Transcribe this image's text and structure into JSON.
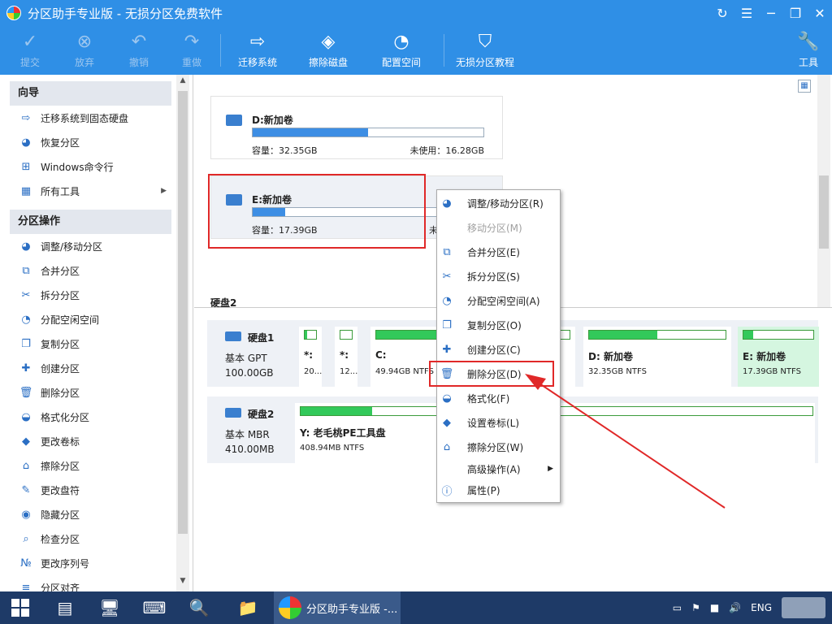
{
  "window": {
    "title": "分区助手专业版 - 无损分区免费软件",
    "controls": [
      "↻",
      "☰",
      "─",
      "❐",
      "✕"
    ]
  },
  "toolbar": {
    "commit": "提交",
    "discard": "放弃",
    "undo": "撤销",
    "redo": "重做",
    "migrate_os": "迁移系统",
    "wipe_disk": "擦除磁盘",
    "allocate_space": "配置空间",
    "tutorial": "无损分区教程",
    "tools": "工具"
  },
  "sidebar": {
    "wizard_title": "向导",
    "wizard_items": [
      {
        "label": "迁移系统到固态硬盘",
        "icon": "migrate-icon"
      },
      {
        "label": "恢复分区",
        "icon": "recover-icon"
      },
      {
        "label": "Windows命令行",
        "icon": "windows-icon"
      },
      {
        "label": "所有工具",
        "icon": "grid-icon"
      }
    ],
    "ops_title": "分区操作",
    "ops_items": [
      {
        "label": "调整/移动分区",
        "icon": "resize-icon"
      },
      {
        "label": "合并分区",
        "icon": "merge-icon"
      },
      {
        "label": "拆分分区",
        "icon": "split-icon"
      },
      {
        "label": "分配空闲空间",
        "icon": "pie-icon"
      },
      {
        "label": "复制分区",
        "icon": "copy-icon"
      },
      {
        "label": "创建分区",
        "icon": "create-icon"
      },
      {
        "label": "删除分区",
        "icon": "trash-icon"
      },
      {
        "label": "格式化分区",
        "icon": "format-icon"
      },
      {
        "label": "更改卷标",
        "icon": "tag-icon"
      },
      {
        "label": "擦除分区",
        "icon": "wipe-icon"
      },
      {
        "label": "更改盘符",
        "icon": "pencil-icon"
      },
      {
        "label": "隐藏分区",
        "icon": "eye-icon"
      },
      {
        "label": "检查分区",
        "icon": "search-icon"
      },
      {
        "label": "更改序列号",
        "icon": "serial-icon"
      },
      {
        "label": "分区对齐",
        "icon": "align-icon"
      }
    ]
  },
  "volumes": [
    {
      "name": "D:新加卷",
      "capacity": "容量：32.35GB",
      "free": "未使用：16.28GB",
      "used_fraction": 0.5
    },
    {
      "name": "E:新加卷",
      "capacity": "容量：17.39GB",
      "free": "未使",
      "used_fraction": 0.14
    }
  ],
  "disk2_label": "硬盘2",
  "disks": [
    {
      "name": "硬盘1",
      "type": "基本 GPT",
      "size": "100.00GB",
      "partitions": [
        {
          "name": "*:",
          "detail": "20...",
          "used_fraction": 0.2
        },
        {
          "name": "*:",
          "detail": "12...",
          "used_fraction": 0.0
        },
        {
          "name": "C:",
          "detail": "49.94GB NTFS",
          "used_fraction": 0.55
        },
        {
          "name": "",
          "detail": "",
          "used_fraction": 0.3
        },
        {
          "name": "D: 新加卷",
          "detail": "32.35GB NTFS",
          "used_fraction": 0.5
        },
        {
          "name": "E: 新加卷",
          "detail": "17.39GB NTFS",
          "used_fraction": 0.14
        }
      ]
    },
    {
      "name": "硬盘2",
      "type": "基本 MBR",
      "size": "410.00MB",
      "partitions": [
        {
          "name": "Y: 老毛桃PE工具盘",
          "detail": "408.94MB NTFS",
          "used_fraction": 0.14
        }
      ]
    }
  ],
  "context_menu": [
    {
      "label": "调整/移动分区(R)",
      "icon": "resize-icon",
      "enabled": true
    },
    {
      "label": "移动分区(M)",
      "icon": "",
      "enabled": false
    },
    {
      "label": "合并分区(E)",
      "icon": "merge-icon",
      "enabled": true
    },
    {
      "label": "拆分分区(S)",
      "icon": "split-icon",
      "enabled": true
    },
    {
      "label": "分配空闲空间(A)",
      "icon": "pie-icon",
      "enabled": true
    },
    {
      "label": "复制分区(O)",
      "icon": "copy-icon",
      "enabled": true
    },
    {
      "label": "创建分区(C)",
      "icon": "create-icon",
      "enabled": true
    },
    {
      "label": "删除分区(D)",
      "icon": "trash-icon",
      "enabled": true
    },
    {
      "label": "格式化(F)",
      "icon": "format-icon",
      "enabled": true
    },
    {
      "label": "设置卷标(L)",
      "icon": "tag-icon",
      "enabled": true
    },
    {
      "label": "擦除分区(W)",
      "icon": "wipe-icon",
      "enabled": true
    },
    {
      "label": "高级操作(A)",
      "icon": "",
      "enabled": true,
      "submenu": true
    },
    {
      "label": "属性(P)",
      "icon": "info-icon",
      "enabled": true
    }
  ],
  "taskbar": {
    "active_app": "分区助手专业版 -...",
    "lang": "ENG"
  },
  "colors": {
    "accent": "#2f8fe6",
    "highlight": "#e02828",
    "bar_fill": "#3d8ee4",
    "green": "#32c95a"
  }
}
